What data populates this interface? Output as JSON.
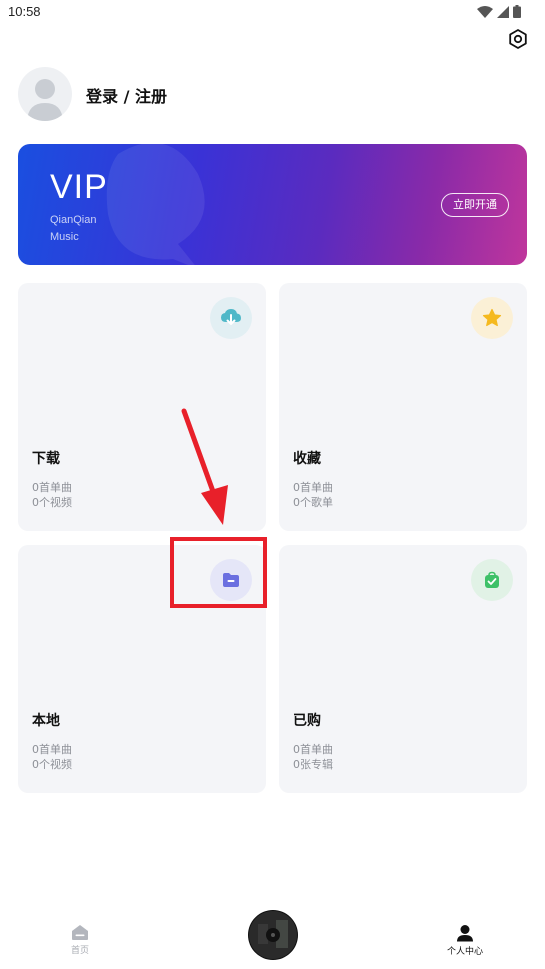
{
  "status_bar": {
    "time": "10:58"
  },
  "profile": {
    "login_label": "登录 / 注册"
  },
  "vip": {
    "title": "VIP",
    "subtitle": "QianQian\nMusic",
    "button": "立即开通"
  },
  "cards": [
    {
      "title": "下载",
      "line1": "0首单曲",
      "line2": "0个视频",
      "icon": "cloud-download-icon",
      "icon_bg": "#e2eff3",
      "icon_color": "#4fb8c8"
    },
    {
      "title": "收藏",
      "line1": "0首单曲",
      "line2": "0个歌单",
      "icon": "star-icon",
      "icon_bg": "#fbf0d6",
      "icon_color": "#f5b91e"
    },
    {
      "title": "本地",
      "line1": "0首单曲",
      "line2": "0个视频",
      "icon": "folder-icon",
      "icon_bg": "#e5e6f8",
      "icon_color": "#6b6fe0"
    },
    {
      "title": "已购",
      "line1": "0首单曲",
      "line2": "0张专辑",
      "icon": "purchased-bag-icon",
      "icon_bg": "#e1f2e6",
      "icon_color": "#3ec168"
    }
  ],
  "nav": {
    "home_label": "首页",
    "profile_label": "个人中心"
  },
  "colors": {
    "annotation": "#e8202a",
    "nav_active": "#111111",
    "nav_inactive": "#a9acb3"
  }
}
